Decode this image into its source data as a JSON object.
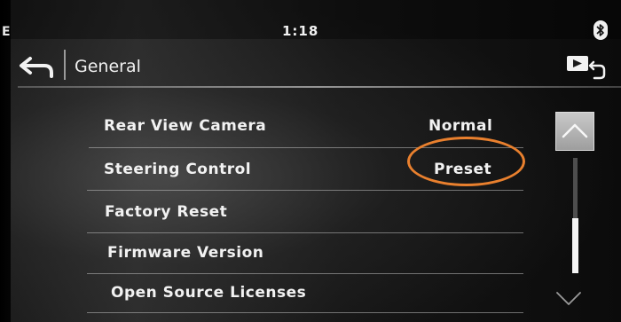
{
  "status_bar": {
    "left_indicator": "E",
    "clock": "1:18",
    "bluetooth_icon": "bluetooth-icon"
  },
  "header": {
    "back_icon": "back-arrow-icon",
    "title": "General",
    "source_icon": "source-return-icon"
  },
  "list": {
    "items": [
      {
        "label": "Rear View Camera",
        "value": "Normal"
      },
      {
        "label": "Steering Control",
        "value": "Preset"
      },
      {
        "label": "Factory Reset",
        "value": ""
      },
      {
        "label": "Firmware Version",
        "value": ""
      },
      {
        "label": "Open Source Licenses",
        "value": ""
      }
    ],
    "highlighted_item": "Steering Control"
  },
  "scroll": {
    "up_icon": "chevron-up-icon",
    "down_icon": "chevron-down-icon",
    "position": 0.75
  },
  "colors": {
    "highlight_ring": "#e9802e",
    "text": "#f2f2f2"
  }
}
